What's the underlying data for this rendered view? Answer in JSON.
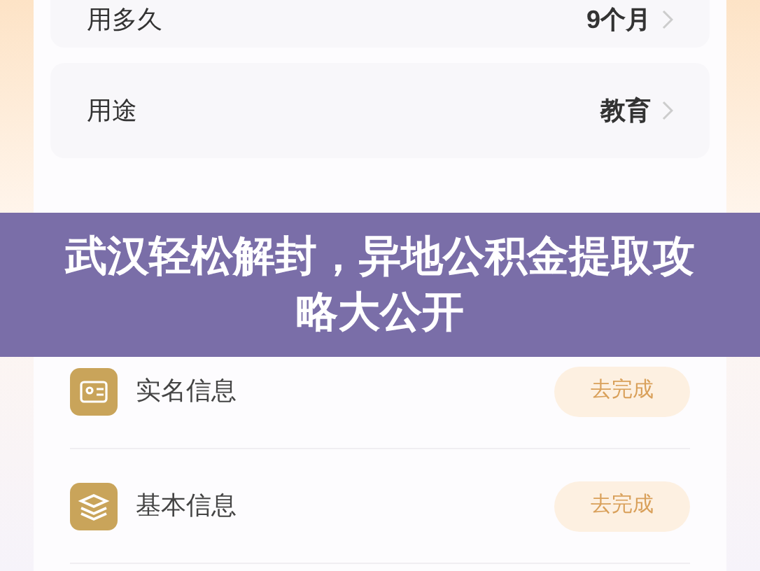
{
  "settings_rows": [
    {
      "label": "用多久",
      "value": "9个月"
    },
    {
      "label": "用途",
      "value": "教育"
    }
  ],
  "banner": {
    "title": "武汉轻松解封，异地公积金提取攻略大公开"
  },
  "tasks": [
    {
      "kind": "id",
      "label": "实名信息",
      "button": "去完成"
    },
    {
      "kind": "layers",
      "label": "基本信息",
      "button": "去完成"
    }
  ]
}
